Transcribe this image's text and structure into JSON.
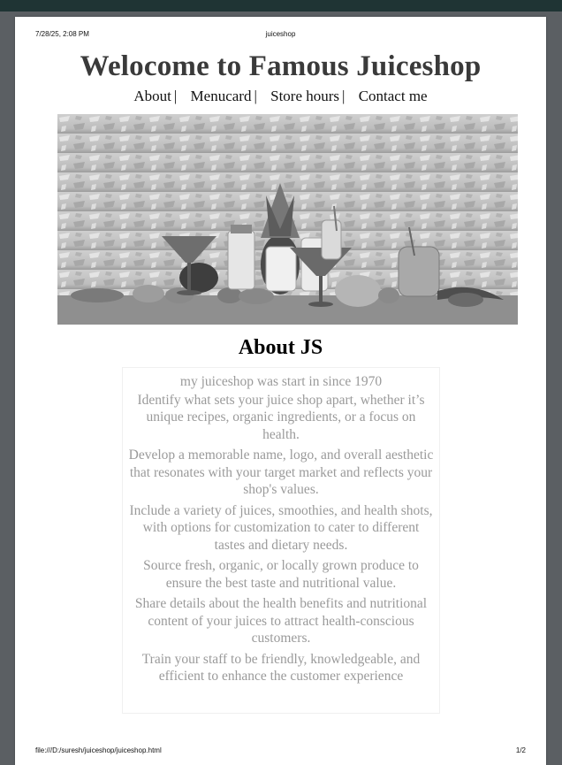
{
  "print_header": {
    "datetime": "7/28/25, 2:08 PM",
    "doc_title": "juiceshop"
  },
  "page": {
    "title": "Welocome to Famous Juiceshop",
    "nav": [
      {
        "label": "About",
        "sep": "|"
      },
      {
        "label": "Menucard",
        "sep": "|"
      },
      {
        "label": "Store hours",
        "sep": "|"
      },
      {
        "label": "Contact me",
        "sep": ""
      }
    ],
    "hero_image": {
      "icon": "juice-glasses-fruit-photo",
      "colors": [
        "#d9d9d9",
        "#888888",
        "#3a3a3a"
      ]
    },
    "about": {
      "heading": "About JS",
      "paragraphs": [
        "my juiceshop was start in since 1970",
        "Identify what sets your juice shop apart, whether it’s unique recipes, organic ingredients, or a focus on health.",
        "Develop a memorable name, logo, and overall aesthetic that resonates with your target market and reflects your shop's values.",
        "Include a variety of juices, smoothies, and health shots, with options for customization to cater to different tastes and dietary needs.",
        "Source fresh, organic, or locally grown produce to ensure the best taste and nutritional value.",
        "Share details about the health benefits and nutritional content of your juices to attract health-conscious customers.",
        "Train your staff to be friendly, knowledgeable, and efficient to enhance the customer experience"
      ]
    }
  },
  "print_footer": {
    "path": "file:///D:/suresh/juiceshop/juiceshop.html",
    "page_number": "1/2"
  }
}
